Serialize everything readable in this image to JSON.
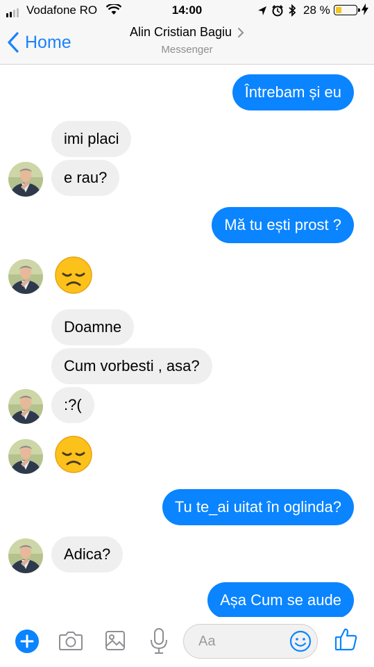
{
  "status_bar": {
    "carrier": "Vodafone RO",
    "time": "14:00",
    "battery_pct": "28 %",
    "battery_level": 0.28
  },
  "nav": {
    "back_label": "Home",
    "contact_name": "Alin Cristian Bagiu",
    "subtitle": "Messenger"
  },
  "messages": [
    {
      "dir": "out",
      "text": "Întrebam  și eu"
    },
    {
      "dir": "in",
      "text": "imi placi"
    },
    {
      "dir": "in",
      "text": "e rau?"
    },
    {
      "dir": "out",
      "text": "Mă tu ești prost ?"
    },
    {
      "dir": "in",
      "emoji": "disappointed-face"
    },
    {
      "dir": "in",
      "text": "Doamne"
    },
    {
      "dir": "in",
      "text": "Cum vorbesti , asa?"
    },
    {
      "dir": "in",
      "text": ":?("
    },
    {
      "dir": "in",
      "emoji": "disappointed-face"
    },
    {
      "dir": "out",
      "text": "Tu te_ai uitat în oglinda?"
    },
    {
      "dir": "in",
      "text": "Adica?"
    },
    {
      "dir": "out",
      "text": "Așa Cum se aude"
    }
  ],
  "composer": {
    "placeholder": "Aa",
    "icons": [
      "plus-icon",
      "camera-icon",
      "gallery-icon",
      "microphone-icon",
      "emoji-icon",
      "like-icon"
    ]
  },
  "colors": {
    "accent": "#0a84ff",
    "incoming_bubble": "#efefef",
    "link_blue": "#1a82fb"
  }
}
